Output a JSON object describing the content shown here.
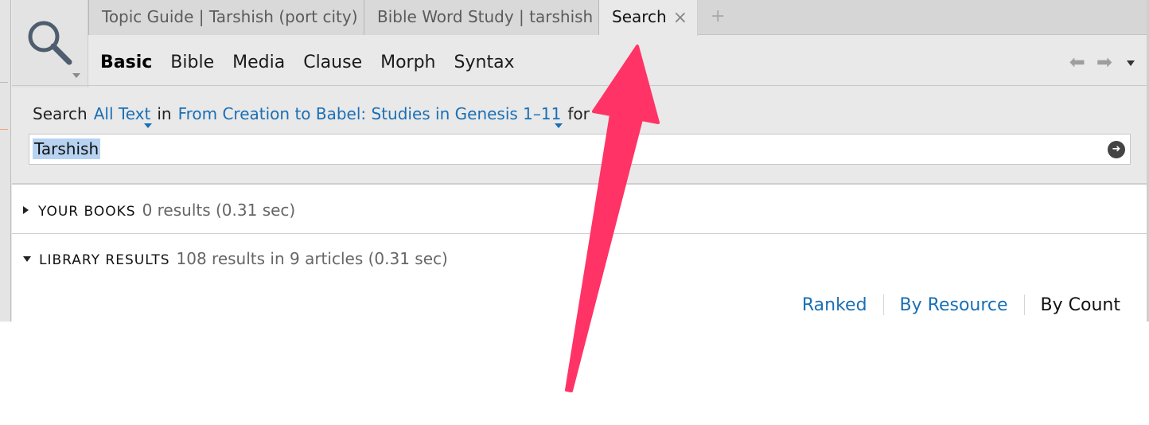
{
  "tabs": [
    {
      "label": "Topic Guide | Tarshish (port city)"
    },
    {
      "label": "Bible Word Study | tarshish"
    },
    {
      "label": "Search",
      "close": "×"
    }
  ],
  "new_tab_label": "+",
  "search_types": [
    "Basic",
    "Bible",
    "Media",
    "Clause",
    "Morph",
    "Syntax"
  ],
  "search_line": {
    "prefix": "Search",
    "scope": "All Text",
    "in": "in",
    "resource": "From Creation to Babel: Studies in Genesis 1–11",
    "for": "for"
  },
  "query": "Tarshish",
  "results": {
    "your_books": {
      "label": "YOUR BOOKS",
      "summary": "0 results (0.31 sec)"
    },
    "library": {
      "label": "LIBRARY RESULTS",
      "summary": "108 results in 9 articles (0.31 sec)"
    }
  },
  "sort_options": [
    "Ranked",
    "By Resource",
    "By Count"
  ],
  "colors": {
    "link": "#1a6fb5",
    "annotation_arrow": "#ff3366",
    "selection": "#b7d3f1"
  },
  "icons": [
    "search-icon",
    "close-icon",
    "back-arrow-icon",
    "forward-arrow-icon",
    "dropdown-icon",
    "go-icon",
    "expand-triangle-icon",
    "collapse-triangle-icon"
  ]
}
